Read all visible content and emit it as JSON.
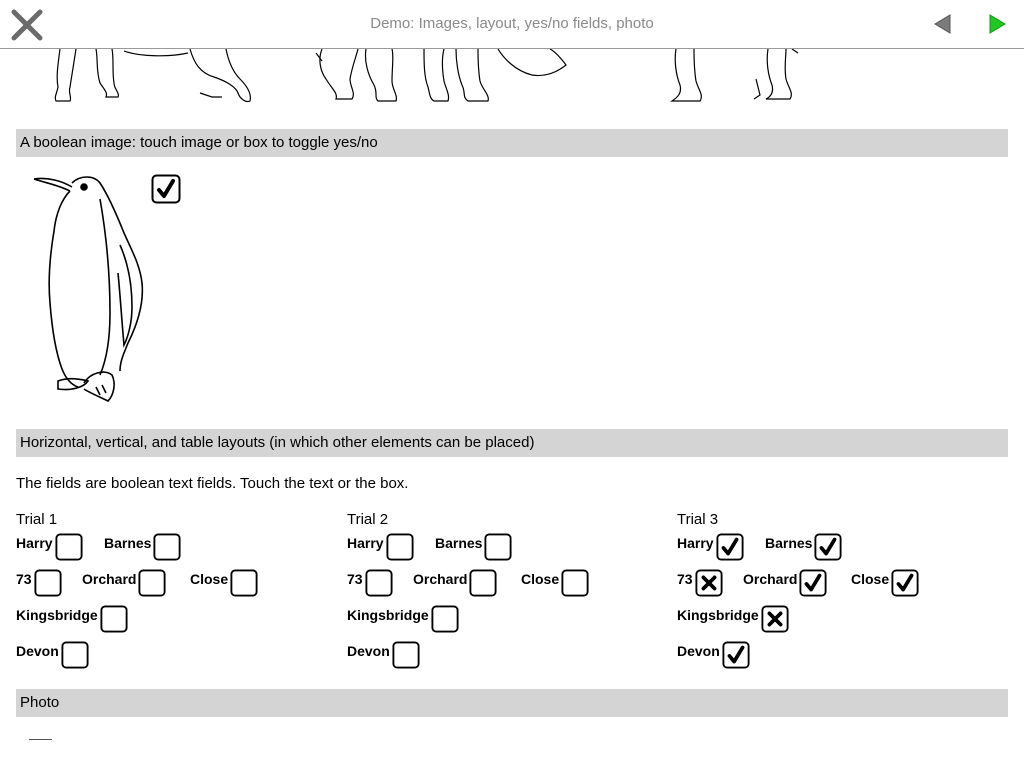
{
  "header": {
    "title": "Demo: Images, layout, yes/no fields, photo"
  },
  "sections": {
    "boolean_image": "A boolean image: touch image or box to toggle yes/no",
    "layouts": "Horizontal, vertical, and table layouts (in which other elements can be placed)",
    "photo": "Photo"
  },
  "boolean_image": {
    "value": "yes"
  },
  "layouts_text": "The fields are boolean text fields. Touch the text or the box.",
  "trials": [
    {
      "title": "Trial 1",
      "fields": {
        "harry": {
          "label": "Harry",
          "state": "empty"
        },
        "barnes": {
          "label": "Barnes",
          "state": "empty"
        },
        "n73": {
          "label": "73",
          "state": "empty"
        },
        "orchard": {
          "label": "Orchard",
          "state": "empty"
        },
        "close": {
          "label": "Close",
          "state": "empty"
        },
        "kingsbridge": {
          "label": "Kingsbridge",
          "state": "empty"
        },
        "devon": {
          "label": "Devon",
          "state": "empty"
        }
      }
    },
    {
      "title": "Trial 2",
      "fields": {
        "harry": {
          "label": "Harry",
          "state": "empty"
        },
        "barnes": {
          "label": "Barnes",
          "state": "empty"
        },
        "n73": {
          "label": "73",
          "state": "empty"
        },
        "orchard": {
          "label": "Orchard",
          "state": "empty"
        },
        "close": {
          "label": "Close",
          "state": "empty"
        },
        "kingsbridge": {
          "label": "Kingsbridge",
          "state": "empty"
        },
        "devon": {
          "label": "Devon",
          "state": "empty"
        }
      }
    },
    {
      "title": "Trial 3",
      "fields": {
        "harry": {
          "label": "Harry",
          "state": "check"
        },
        "barnes": {
          "label": "Barnes",
          "state": "check"
        },
        "n73": {
          "label": "73",
          "state": "cross"
        },
        "orchard": {
          "label": "Orchard",
          "state": "check"
        },
        "close": {
          "label": "Close",
          "state": "check"
        },
        "kingsbridge": {
          "label": "Kingsbridge",
          "state": "cross"
        },
        "devon": {
          "label": "Devon",
          "state": "check"
        }
      }
    }
  ]
}
